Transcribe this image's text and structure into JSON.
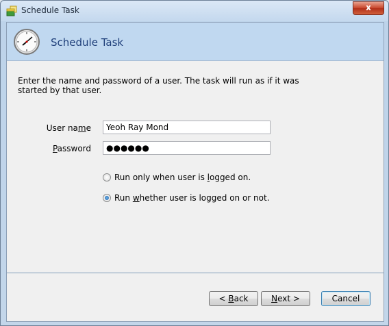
{
  "window": {
    "title": "Schedule Task",
    "close_label": "x"
  },
  "header": {
    "title": "Schedule Task"
  },
  "content": {
    "description": "Enter the name and password of a user.  The task will run as if it was started by that user.",
    "user_name": {
      "label_pre": "User na",
      "label_hotkey": "m",
      "label_post": "e",
      "value": "Yeoh Ray Mond"
    },
    "password": {
      "label_pre": "",
      "label_hotkey": "P",
      "label_post": "assword",
      "value": "●●●●●●"
    },
    "radio_options": [
      {
        "pre": "Run only when user is ",
        "hotkey": "l",
        "post": "ogged on.",
        "checked": false
      },
      {
        "pre": "Run ",
        "hotkey": "w",
        "post": "hether user is logged on or not.",
        "checked": true
      }
    ]
  },
  "buttons": {
    "back": {
      "pre": "< ",
      "hotkey": "B",
      "post": "ack"
    },
    "next": {
      "pre": "",
      "hotkey": "N",
      "post": "ext >"
    },
    "cancel": {
      "pre": "Cancel",
      "hotkey": "",
      "post": ""
    }
  }
}
